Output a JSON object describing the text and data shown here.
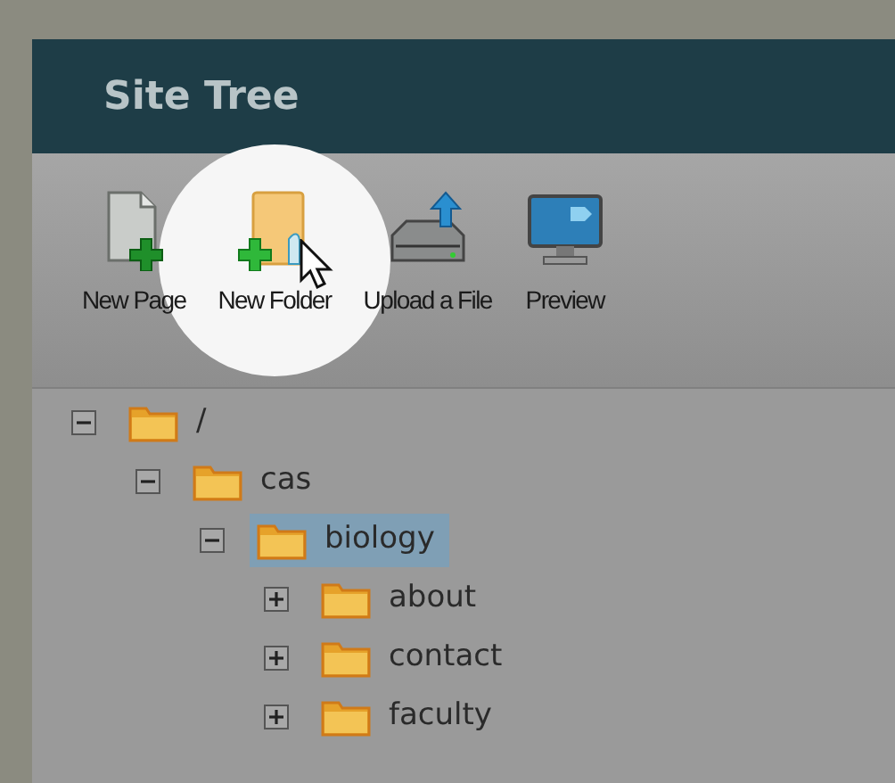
{
  "panel": {
    "title": "Site Tree"
  },
  "toolbar": [
    {
      "label": "New Page",
      "kind": "page",
      "highlighted": false
    },
    {
      "label": "New Folder",
      "kind": "folder",
      "highlighted": true
    },
    {
      "label": "Upload a File",
      "kind": "upload",
      "highlighted": false
    },
    {
      "label": "Preview",
      "kind": "preview",
      "highlighted": false
    }
  ],
  "tree": [
    {
      "label": "/",
      "expanded": true,
      "selected": false,
      "children": [
        {
          "label": "cas",
          "expanded": true,
          "selected": false,
          "children": [
            {
              "label": "biology",
              "expanded": true,
              "selected": true,
              "children": [
                {
                  "label": "about",
                  "expanded": false,
                  "selected": false
                },
                {
                  "label": "contact",
                  "expanded": false,
                  "selected": false
                },
                {
                  "label": "faculty",
                  "expanded": false,
                  "selected": false
                }
              ]
            }
          ]
        }
      ]
    }
  ]
}
